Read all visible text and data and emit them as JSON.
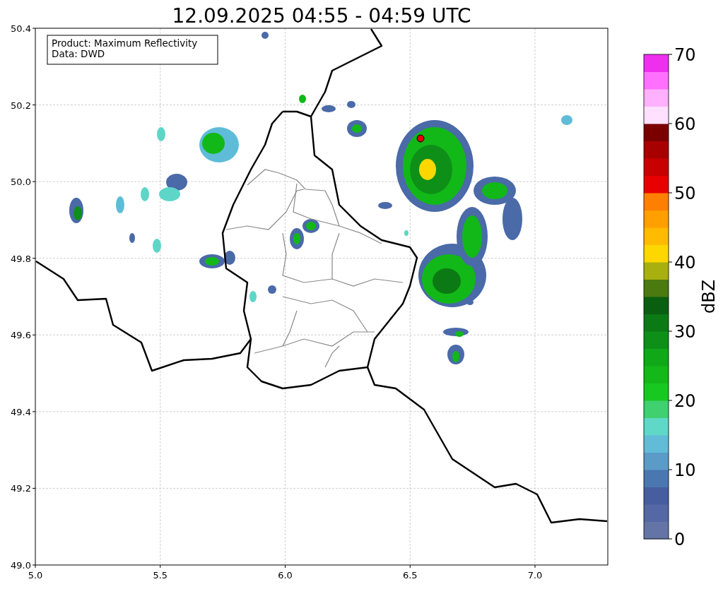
{
  "title": "12.09.2025 04:55 - 04:59 UTC",
  "legend": [
    "Product: Maximum Reflectivity",
    "Data: DWD"
  ],
  "y_axis": {
    "ticks": [
      "50.4",
      "50.2",
      "50.0",
      "49.8",
      "49.6",
      "49.4",
      "49.2",
      "49.0"
    ]
  },
  "x_axis": {
    "ticks": [
      "5.0",
      "5.5",
      "6.0",
      "6.5",
      "7.0"
    ]
  },
  "colorbar": {
    "label": "dBZ",
    "ticks": [
      "70",
      "60",
      "50",
      "40",
      "30",
      "20",
      "10",
      "0"
    ]
  }
}
